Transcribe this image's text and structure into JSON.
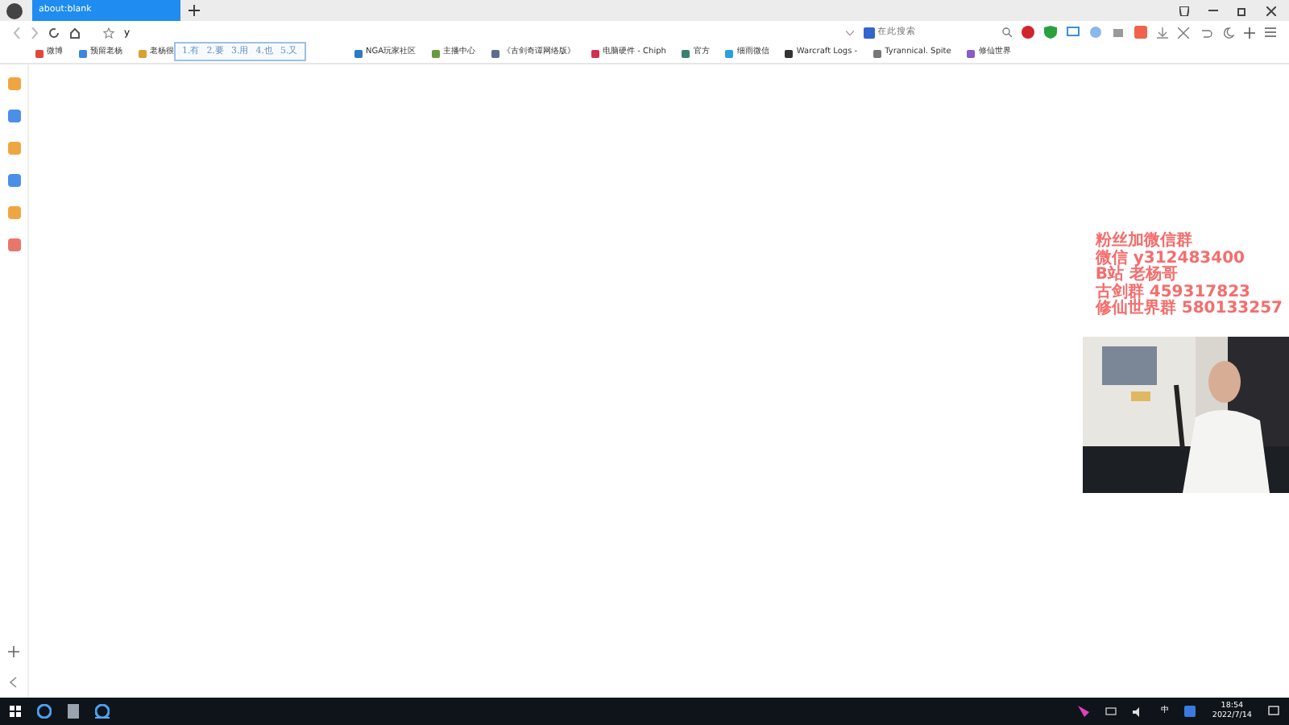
{
  "tabs": [
    {
      "title": "about:blank",
      "selected": true
    }
  ],
  "address": {
    "value": "y"
  },
  "ime": {
    "candidates": [
      "1.有",
      "2.要",
      "3.用",
      "4.也",
      "5.又"
    ]
  },
  "search": {
    "placeholder": "在此搜索"
  },
  "bookmarks": [
    {
      "label": "微博"
    },
    {
      "label": "预留老杨"
    },
    {
      "label": "老杨很"
    },
    {
      "label": "NGA玩家社区"
    },
    {
      "label": "主播中心"
    },
    {
      "label": "《古剑奇谭网络版》"
    },
    {
      "label": "电脑硬件 - Chiph"
    },
    {
      "label": "官方"
    },
    {
      "label": "细雨微信"
    },
    {
      "label": "Warcraft Logs -"
    },
    {
      "label": "Tyrannical. Spite"
    },
    {
      "label": "修仙世界"
    }
  ],
  "sidebar": [
    {
      "color": "#f0a640"
    },
    {
      "color": "#4a8fe8"
    },
    {
      "color": "#f0a640"
    },
    {
      "color": "#4a8fe8"
    },
    {
      "color": "#f0a640"
    },
    {
      "color": "#e8766a"
    }
  ],
  "overlay_lines": [
    "粉丝加微信群",
    "微信 y312483400",
    "B站 老杨哥",
    "古剑群 459317823",
    "修仙世界群 580133257"
  ],
  "taskbar": {
    "ime": "中",
    "time": "18:54",
    "date": "2022/7/14"
  }
}
